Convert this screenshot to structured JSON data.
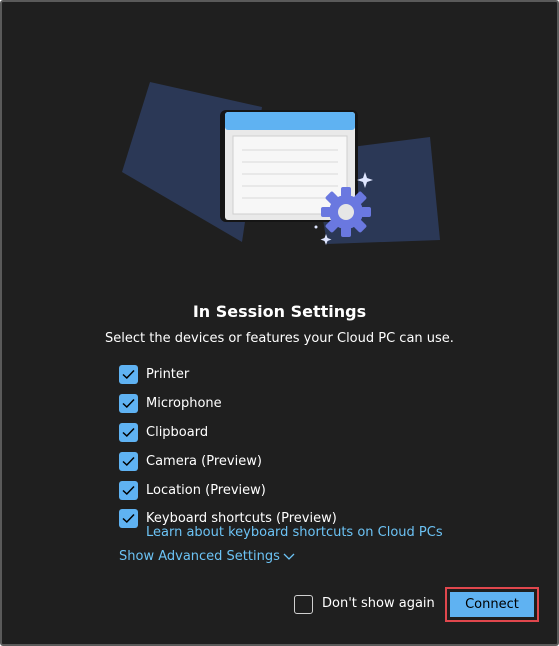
{
  "dialog": {
    "title": "In Session Settings",
    "subtitle": "Select the devices or features your Cloud PC can use."
  },
  "options": [
    {
      "label": "Printer",
      "checked": true
    },
    {
      "label": "Microphone",
      "checked": true
    },
    {
      "label": "Clipboard",
      "checked": true
    },
    {
      "label": "Camera (Preview)",
      "checked": true
    },
    {
      "label": "Location (Preview)",
      "checked": true
    },
    {
      "label": "Keyboard shortcuts (Preview)",
      "checked": true
    }
  ],
  "learn_link": "Learn about keyboard shortcuts on Cloud PCs",
  "advanced_settings": "Show Advanced Settings",
  "footer": {
    "dont_show_label": "Don't show again",
    "dont_show_checked": false,
    "connect_label": "Connect"
  },
  "colors": {
    "background": "#1f1f1f",
    "accent": "#5fb2f2",
    "link": "#6cc3f5",
    "highlight": "#e0474d"
  }
}
